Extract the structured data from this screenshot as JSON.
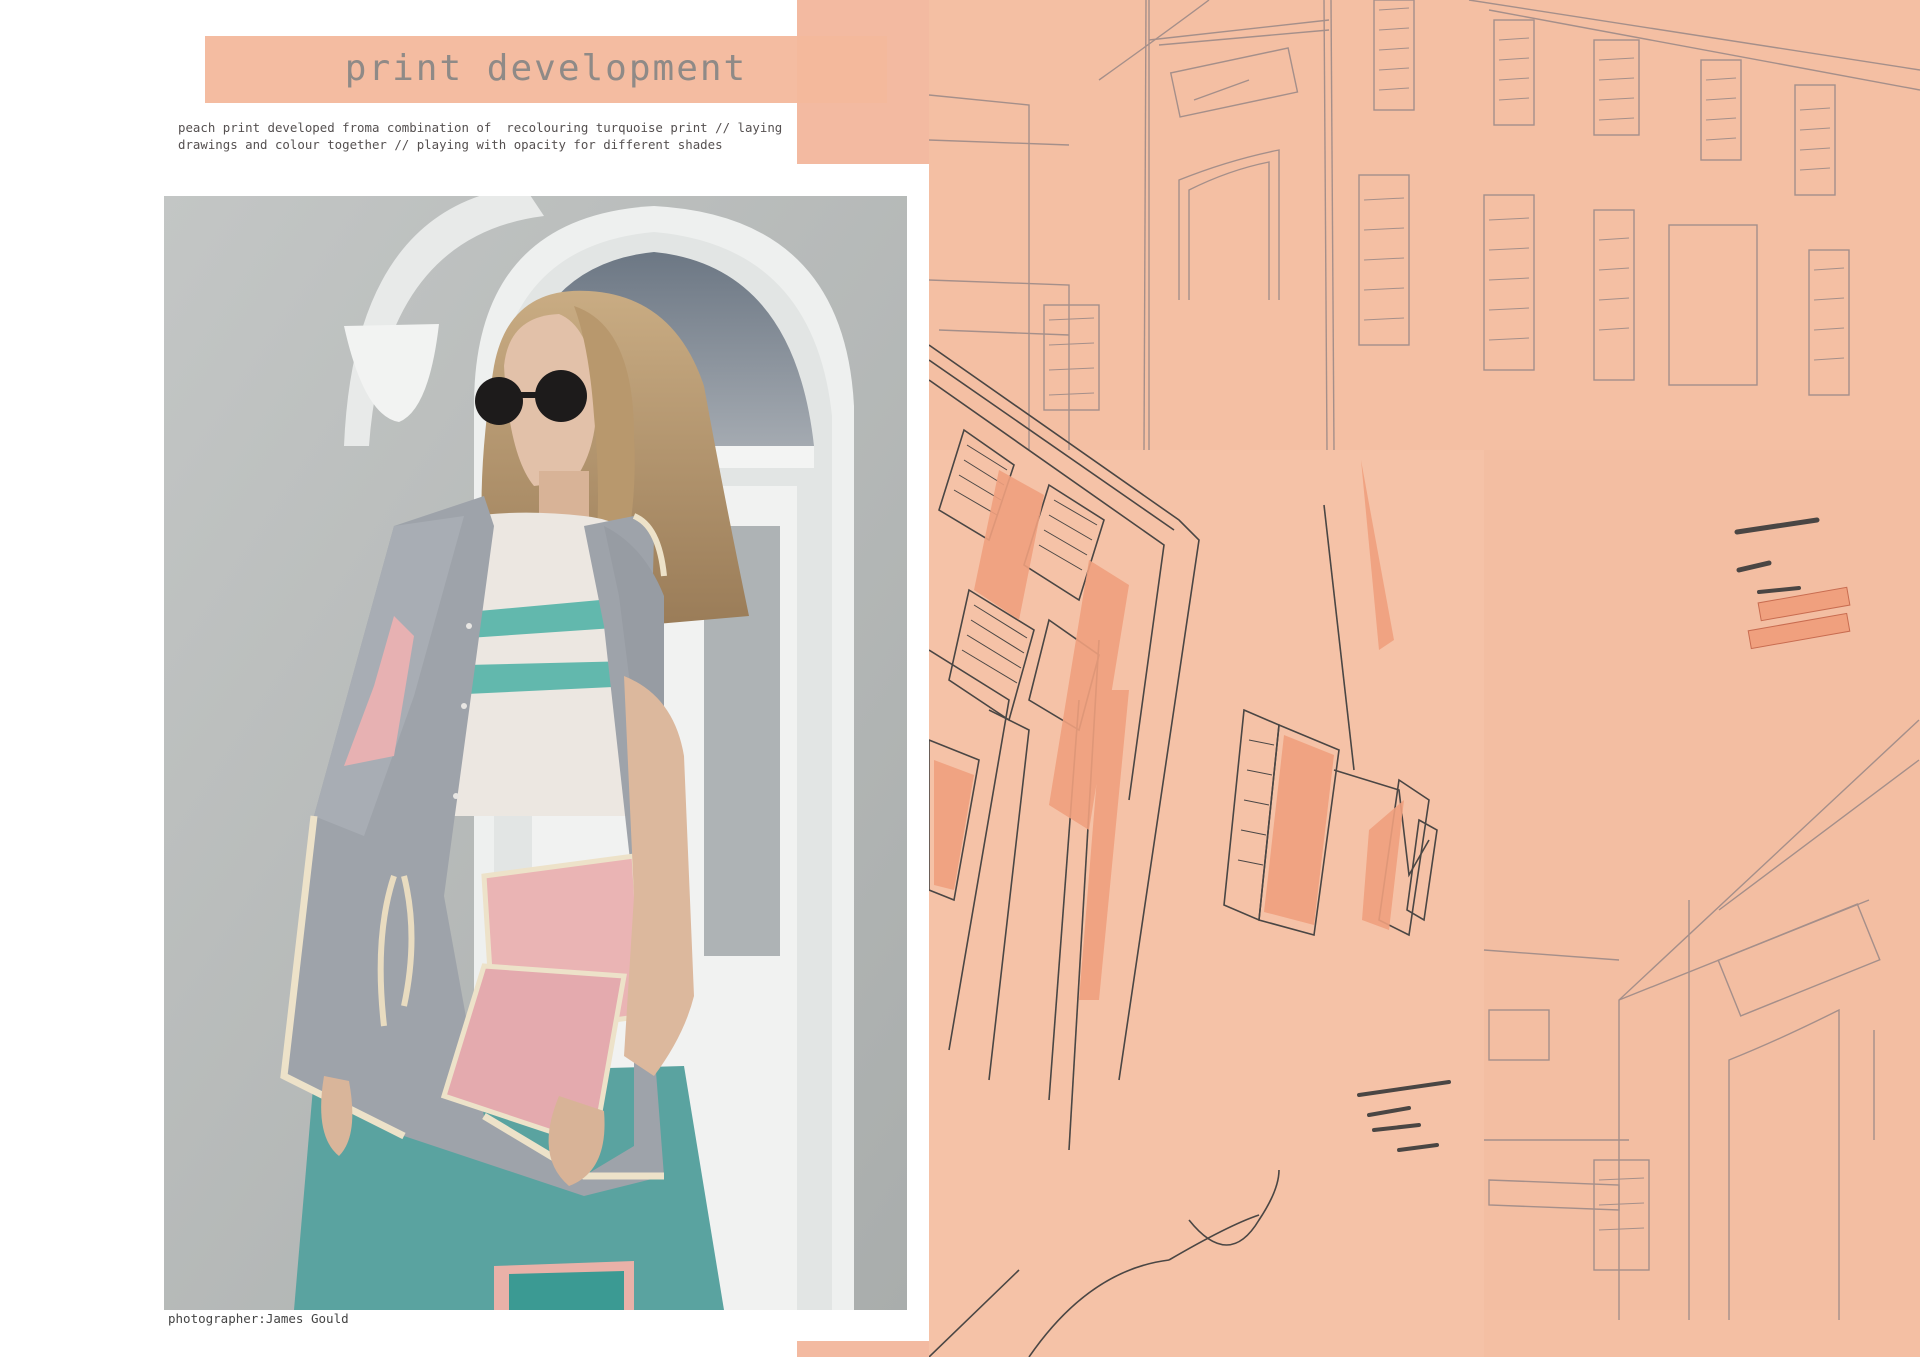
{
  "page": {
    "title": "print development",
    "description_line1": "peach print developed froma combination of  recolouring turquoise print // laying",
    "description_line2": "drawings and colour together // playing with opacity for different shades",
    "photo_credit": "photographer:James Gould"
  },
  "colors": {
    "peach": "#f4bfa3",
    "peach_band": "#f3b89c",
    "sketch_line": "#9f8a86",
    "dark_ink": "#4a4644",
    "photo_wall": "#b9bcbb"
  }
}
